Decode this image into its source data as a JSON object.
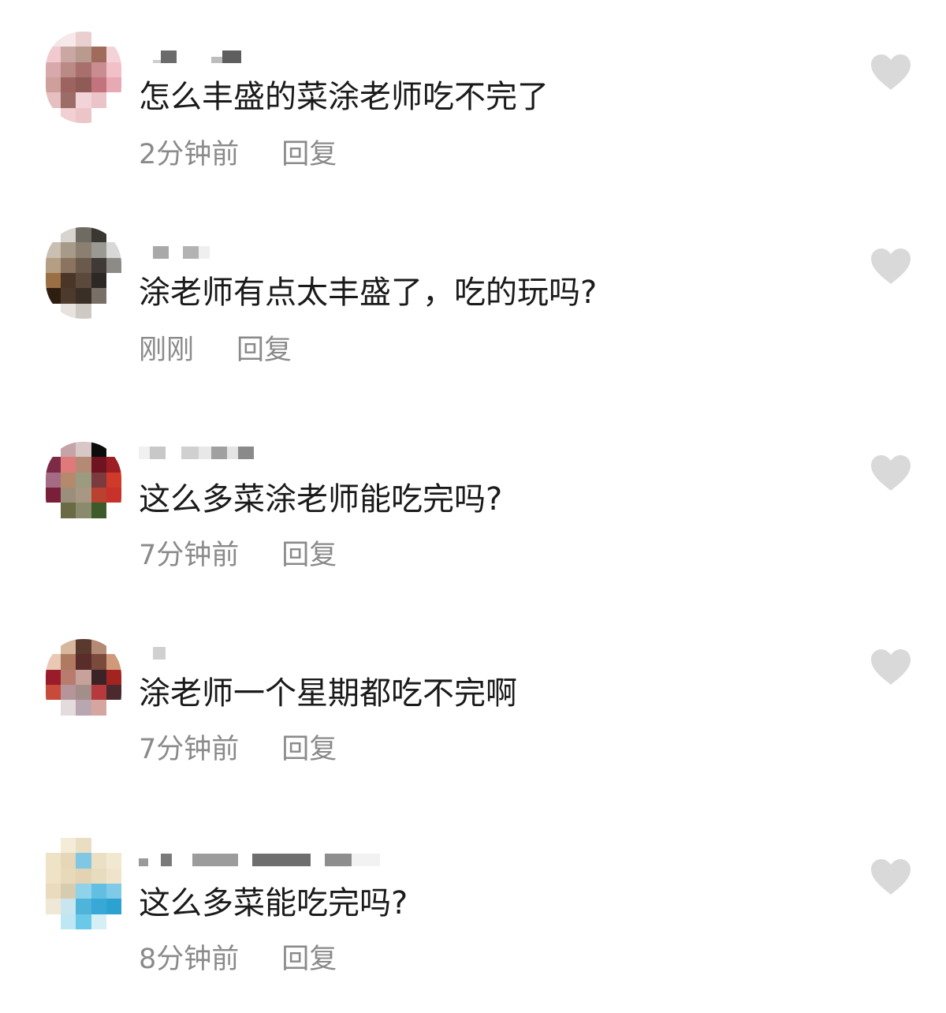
{
  "comments": [
    {
      "username_masked": "",
      "text": "怎么丰盛的菜涂老师吃不完了",
      "time": "2分钟前",
      "reply_label": "回复",
      "like_icon": "heart-icon"
    },
    {
      "username_masked": "",
      "text": "涂老师有点太丰盛了，吃的玩吗?",
      "time": "刚刚",
      "reply_label": "回复",
      "like_icon": "heart-icon"
    },
    {
      "username_masked": "",
      "text": "这么多菜涂老师能吃完吗?",
      "time": "7分钟前",
      "reply_label": "回复",
      "like_icon": "heart-icon"
    },
    {
      "username_masked": "",
      "text": "涂老师一个星期都吃不完啊",
      "time": "7分钟前",
      "reply_label": "回复",
      "like_icon": "heart-icon"
    },
    {
      "username_masked": "",
      "text": "这么多菜能吃完吗?",
      "time": "8分钟前",
      "reply_label": "回复",
      "like_icon": "heart-icon"
    }
  ],
  "colors": {
    "text": "#1a1a1a",
    "meta": "#8a8a8a",
    "heart": "#d9d9d9"
  }
}
